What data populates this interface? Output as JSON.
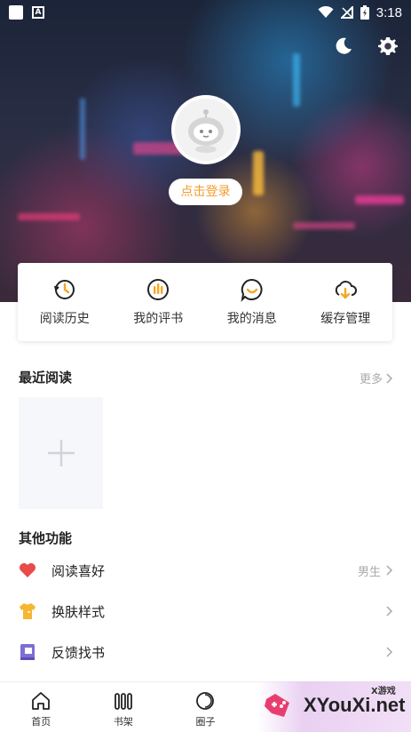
{
  "status_bar": {
    "time": "3:18",
    "notification_icon_label": "A"
  },
  "header": {
    "login_label": "点击登录"
  },
  "quick_actions": [
    {
      "label": "阅读历史",
      "icon": "history-icon"
    },
    {
      "label": "我的评书",
      "icon": "review-icon"
    },
    {
      "label": "我的消息",
      "icon": "message-icon"
    },
    {
      "label": "缓存管理",
      "icon": "cache-download-icon"
    }
  ],
  "recent": {
    "title": "最近阅读",
    "more_label": "更多"
  },
  "other": {
    "title": "其他功能",
    "items": [
      {
        "label": "阅读喜好",
        "value": "男生",
        "icon": "heart-icon",
        "color": "#e94b4b"
      },
      {
        "label": "换肤样式",
        "value": "",
        "icon": "shirt-icon",
        "color": "#f5b731"
      },
      {
        "label": "反馈找书",
        "value": "",
        "icon": "book-icon",
        "color": "#7b6fd6"
      }
    ]
  },
  "bottom_nav": [
    {
      "label": "首页",
      "icon": "home-icon"
    },
    {
      "label": "书架",
      "icon": "bookshelf-icon"
    },
    {
      "label": "圈子",
      "icon": "circle-icon"
    }
  ],
  "watermark": {
    "small": "X游戏",
    "big": "XYouXi.net"
  },
  "colors": {
    "accent": "#f39b2c",
    "text": "#222222",
    "muted": "#aaaaaa"
  }
}
